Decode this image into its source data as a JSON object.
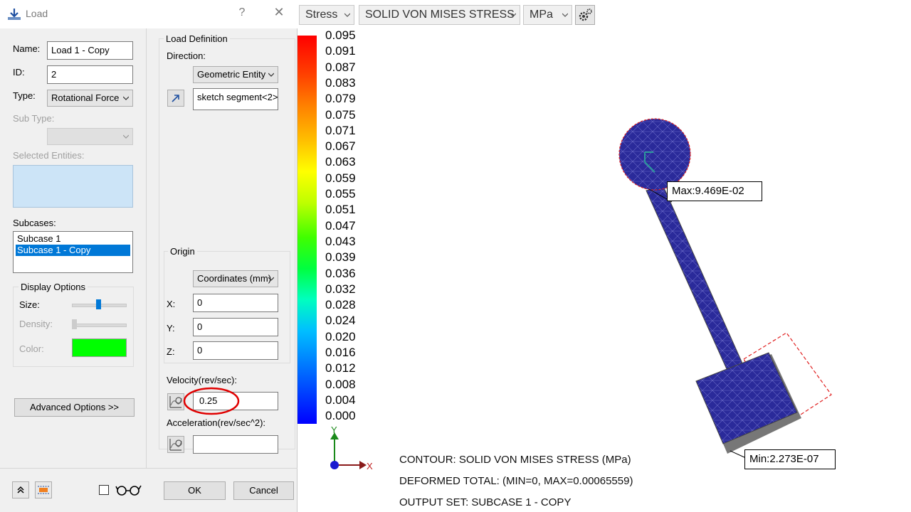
{
  "dialog": {
    "title": "Load",
    "help_glyph": "?",
    "close_glyph": "✕",
    "name_label": "Name:",
    "name_value": "Load 1 - Copy",
    "id_label": "ID:",
    "id_value": "2",
    "type_label": "Type:",
    "type_value": "Rotational Force",
    "subtype_label": "Sub Type:",
    "subtype_value": "",
    "selected_entities_label": "Selected Entities:",
    "subcases_label": "Subcases:",
    "subcases": [
      "Subcase 1",
      "Subcase 1 - Copy"
    ],
    "display_options": {
      "title": "Display Options",
      "size_label": "Size:",
      "density_label": "Density:",
      "color_label": "Color:",
      "color_value": "#00ff00"
    },
    "advanced_button": "Advanced Options >>",
    "load_definition": {
      "title": "Load Definition",
      "direction_label": "Direction:",
      "direction_type": "Geometric Entity",
      "direction_entity": "sketch segment<2>"
    },
    "origin": {
      "title": "Origin",
      "type": "Coordinates (mm)",
      "x_label": "X:",
      "x_value": "0",
      "y_label": "Y:",
      "y_value": "0",
      "z_label": "Z:",
      "z_value": "0"
    },
    "velocity_label": "Velocity(rev/sec):",
    "velocity_value": "0.25",
    "acceleration_label": "Acceleration(rev/sec^2):",
    "acceleration_value": "",
    "ok_button": "OK",
    "cancel_button": "Cancel"
  },
  "viewer": {
    "result_type": "Stress",
    "component": "SOLID VON MISES STRESS",
    "units": "MPa",
    "legend_values": [
      "0.095",
      "0.091",
      "0.087",
      "0.083",
      "0.079",
      "0.075",
      "0.071",
      "0.067",
      "0.063",
      "0.059",
      "0.055",
      "0.051",
      "0.047",
      "0.043",
      "0.039",
      "0.036",
      "0.032",
      "0.028",
      "0.024",
      "0.020",
      "0.016",
      "0.012",
      "0.008",
      "0.004",
      "0.000"
    ],
    "axis_y": "Y",
    "axis_x": "X",
    "max_label": "Max:9.469E-02",
    "min_label": "Min:2.273E-07",
    "captions": [
      "CONTOUR: SOLID VON MISES STRESS (MPa)",
      "DEFORMED TOTAL: (MIN=0, MAX=0.00065559)",
      "OUTPUT SET: SUBCASE 1 - COPY"
    ],
    "mesh_color": "#2a2a9a",
    "highlight_color": "#e02020"
  }
}
